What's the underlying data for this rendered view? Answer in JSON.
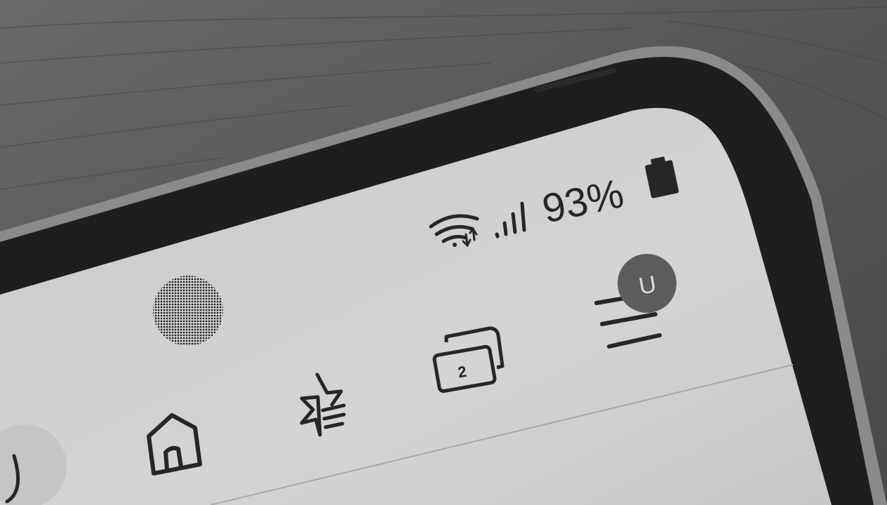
{
  "status_bar": {
    "battery_percent": "93%",
    "wifi_icon": "wifi-data-activity-icon",
    "signal_icon": "cellular-signal-icon",
    "battery_icon": "battery-icon"
  },
  "toolbar": {
    "tab_count": "2",
    "avatar_initial": "U",
    "items": [
      "back-icon",
      "home-icon",
      "bookmarks-icon",
      "tabs-icon",
      "menu-icon"
    ]
  },
  "colors": {
    "table": "#5a5a5a",
    "phone_bezel": "#1e1e1e",
    "screen": "#cfcfcf",
    "icon": "#262626",
    "avatar": "#5c5c5c"
  }
}
